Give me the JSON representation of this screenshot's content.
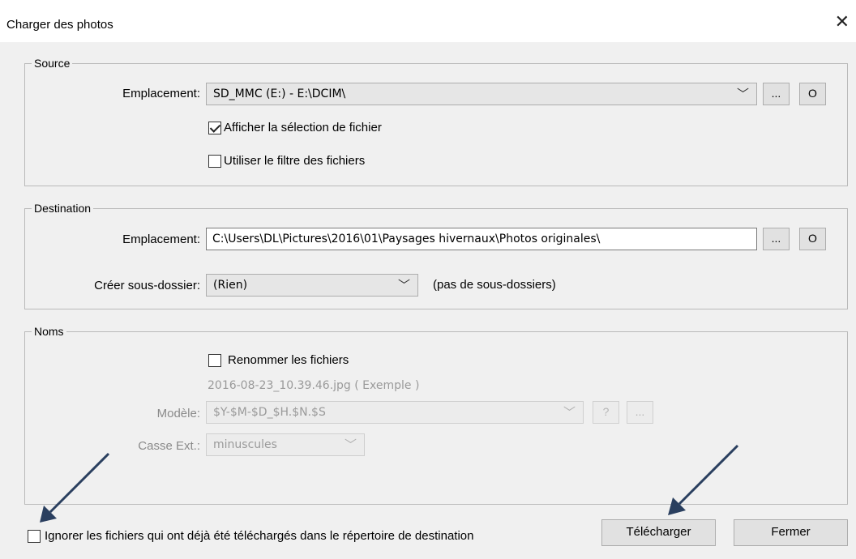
{
  "window": {
    "title": "Charger des photos",
    "close_glyph": "✕"
  },
  "source": {
    "legend": "Source",
    "location_label": "Emplacement:",
    "location_value": "SD_MMC (E:) - E:\\DCIM\\",
    "browse_label": "...",
    "open_label": "O",
    "show_selection": {
      "label": "Afficher la sélection de fichier",
      "checked": true
    },
    "use_filter": {
      "label": "Utiliser le filtre des fichiers",
      "checked": false
    }
  },
  "destination": {
    "legend": "Destination",
    "location_label": "Emplacement:",
    "location_value": "C:\\Users\\DL\\Pictures\\2016\\01\\Paysages hivernaux\\Photos originales\\",
    "browse_label": "...",
    "open_label": "O",
    "subfolder_label": "Créer sous-dossier:",
    "subfolder_value": "(Rien)",
    "subfolder_hint": "(pas de sous-dossiers)"
  },
  "names": {
    "legend": "Noms",
    "rename": {
      "label": "Renommer les fichiers",
      "checked": false
    },
    "example": "2016-08-23_10.39.46.jpg  ( Exemple )",
    "template_label": "Modèle:",
    "template_value": "$Y-$M-$D_$H.$N.$S",
    "help_label": "?",
    "more_label": "...",
    "ext_case_label": "Casse Ext.:",
    "ext_case_value": "minuscules"
  },
  "footer": {
    "ignore": {
      "label": "Ignorer les fichiers qui ont déjà été téléchargés dans le répertoire de destination",
      "checked": false
    },
    "download_label": "Télécharger",
    "close_label": "Fermer"
  },
  "colors": {
    "annotation_arrow": "#2a3f5f",
    "disabled_text": "#8a8a8a"
  }
}
